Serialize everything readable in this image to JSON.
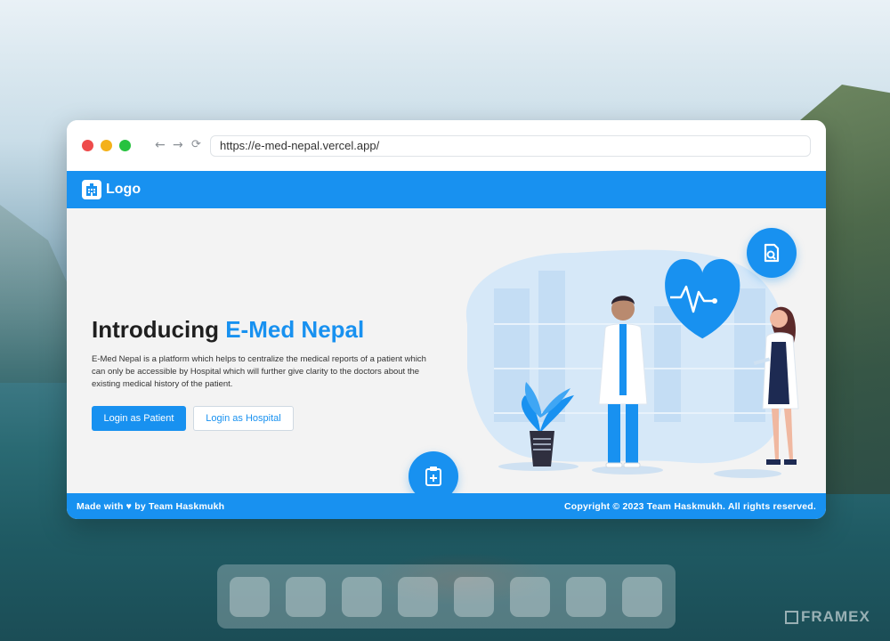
{
  "browser": {
    "url": "https://e-med-nepal.vercel.app/"
  },
  "header": {
    "logo_text": "Logo"
  },
  "hero": {
    "title_plain": "Introducing ",
    "title_accent": "E-Med Nepal",
    "description": "E-Med Nepal is a platform which helps to centralize the medical reports of a patient which can only be accessible by Hospital which will further give clarity to the doctors about the existing medical history of the patient.",
    "btn_patient": "Login as Patient",
    "btn_hospital": "Login as Hospital"
  },
  "footer": {
    "left_text": "Made with ♥ by Team Haskmukh",
    "right_text": "Copyright © 2023 Team Haskmukh. All rights reserved."
  },
  "watermark": {
    "text": "FRAMEX"
  },
  "colors": {
    "accent": "#1891f0"
  },
  "icons": [
    "hospital-logo-icon",
    "back-arrow-icon",
    "forward-arrow-icon",
    "reload-icon",
    "medical-search-icon",
    "clipboard-plus-icon",
    "heart-pulse-icon"
  ]
}
